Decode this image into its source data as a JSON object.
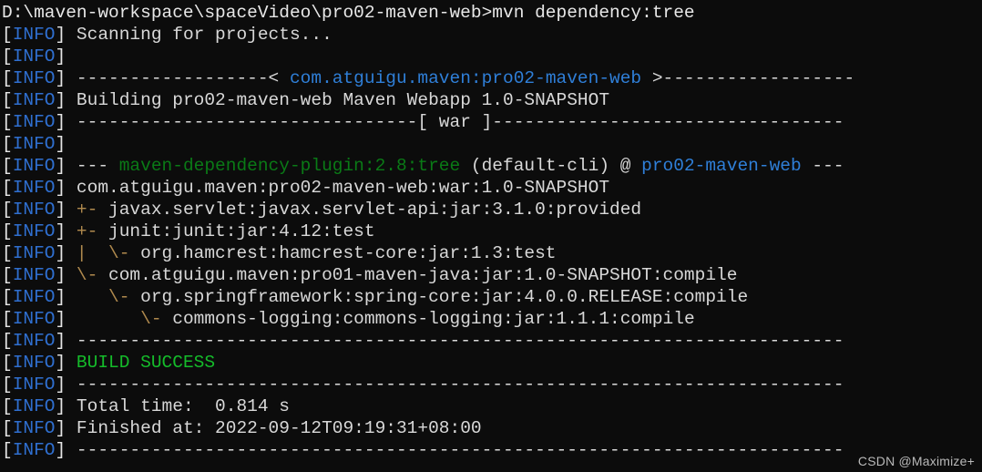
{
  "terminal": {
    "background_color": "#0c0c0c",
    "default_text_color": "#d8d8d8",
    "info_color": "#2f6fd0",
    "accent_blue": "#2f7fd8",
    "accent_green": "#0a7a16",
    "success_green": "#15bb2a",
    "tree_gold": "#b08a4e",
    "prompt": {
      "path": "D:\\maven-workspace\\spaceVideo\\pro02-maven-web",
      "symbol": ">",
      "command": "mvn dependency:tree"
    },
    "info_tag": {
      "open_bracket": "[",
      "label": "INFO",
      "close_bracket": "]"
    },
    "lines": [
      {
        "type": "prompt"
      },
      {
        "type": "info",
        "segments": [
          {
            "text": " Scanning for projects...",
            "color": "default"
          }
        ]
      },
      {
        "type": "info",
        "segments": []
      },
      {
        "type": "info",
        "segments": [
          {
            "text": " ------------------< ",
            "color": "dash"
          },
          {
            "text": "com.atguigu.maven:pro02-maven-web",
            "color": "blue"
          },
          {
            "text": " >------------------",
            "color": "dash"
          }
        ]
      },
      {
        "type": "info",
        "segments": [
          {
            "text": " Building pro02-maven-web Maven Webapp 1.0-SNAPSHOT",
            "color": "default"
          }
        ]
      },
      {
        "type": "info",
        "segments": [
          {
            "text": " --------------------------------[ war ]---------------------------------",
            "color": "dash"
          }
        ]
      },
      {
        "type": "info",
        "segments": []
      },
      {
        "type": "info",
        "segments": [
          {
            "text": " --- ",
            "color": "dash"
          },
          {
            "text": "maven-dependency-plugin:2.8:tree",
            "color": "green"
          },
          {
            "text": " (default-cli) @ ",
            "color": "default"
          },
          {
            "text": "pro02-maven-web",
            "color": "blue"
          },
          {
            "text": " ---",
            "color": "dash"
          }
        ]
      },
      {
        "type": "info",
        "segments": [
          {
            "text": " com.atguigu.maven:pro02-maven-web:war:1.0-SNAPSHOT",
            "color": "default"
          }
        ]
      },
      {
        "type": "info",
        "segments": [
          {
            "text": " +-",
            "color": "gold"
          },
          {
            "text": " javax.servlet:javax.servlet-api:jar:3.1.0:provided",
            "color": "default"
          }
        ]
      },
      {
        "type": "info",
        "segments": [
          {
            "text": " +-",
            "color": "gold"
          },
          {
            "text": " junit:junit:jar:4.12:test",
            "color": "default"
          }
        ]
      },
      {
        "type": "info",
        "segments": [
          {
            "text": " |  \\-",
            "color": "gold"
          },
          {
            "text": " org.hamcrest:hamcrest-core:jar:1.3:test",
            "color": "default"
          }
        ]
      },
      {
        "type": "info",
        "segments": [
          {
            "text": " \\-",
            "color": "gold"
          },
          {
            "text": " com.atguigu.maven:pro01-maven-java:jar:1.0-SNAPSHOT:compile",
            "color": "default"
          }
        ]
      },
      {
        "type": "info",
        "segments": [
          {
            "text": "    \\-",
            "color": "gold"
          },
          {
            "text": " org.springframework:spring-core:jar:4.0.0.RELEASE:compile",
            "color": "default"
          }
        ]
      },
      {
        "type": "info",
        "segments": [
          {
            "text": "       \\-",
            "color": "gold"
          },
          {
            "text": " commons-logging:commons-logging:jar:1.1.1:compile",
            "color": "default"
          }
        ]
      },
      {
        "type": "info",
        "segments": [
          {
            "text": " ------------------------------------------------------------------------",
            "color": "dash"
          }
        ]
      },
      {
        "type": "info",
        "segments": [
          {
            "text": " BUILD SUCCESS",
            "color": "bgreen"
          }
        ]
      },
      {
        "type": "info",
        "segments": [
          {
            "text": " ------------------------------------------------------------------------",
            "color": "dash"
          }
        ]
      },
      {
        "type": "info",
        "segments": [
          {
            "text": " Total time:  0.814 s",
            "color": "default"
          }
        ]
      },
      {
        "type": "info",
        "segments": [
          {
            "text": " Finished at: 2022-09-12T09:19:31+08:00",
            "color": "default"
          }
        ]
      },
      {
        "type": "info",
        "segments": [
          {
            "text": " ------------------------------------------------------------------------",
            "color": "dash"
          }
        ]
      }
    ]
  },
  "watermark": {
    "text": "CSDN @Maximize+"
  }
}
